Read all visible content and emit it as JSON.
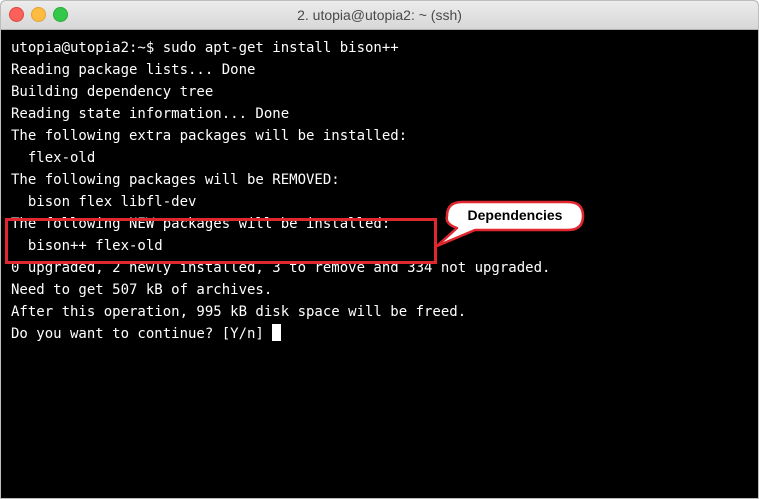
{
  "window": {
    "title": "2. utopia@utopia2: ~ (ssh)"
  },
  "terminal": {
    "lines": [
      "utopia@utopia2:~$ sudo apt-get install bison++",
      "Reading package lists... Done",
      "Building dependency tree",
      "Reading state information... Done",
      "The following extra packages will be installed:",
      "  flex-old",
      "The following packages will be REMOVED:",
      "  bison flex libfl-dev",
      "The following NEW packages will be installed:",
      "  bison++ flex-old",
      "0 upgraded, 2 newly installed, 3 to remove and 334 not upgraded.",
      "Need to get 507 kB of archives.",
      "After this operation, 995 kB disk space will be freed.",
      "Do you want to continue? [Y/n] "
    ]
  },
  "annotation": {
    "label": "Dependencies",
    "box_color": "#e0262e"
  },
  "colors": {
    "terminal_bg": "#000000",
    "terminal_fg": "#ffffff",
    "close": "#fc605b",
    "minimize": "#fdbc40",
    "maximize": "#34c84a"
  }
}
